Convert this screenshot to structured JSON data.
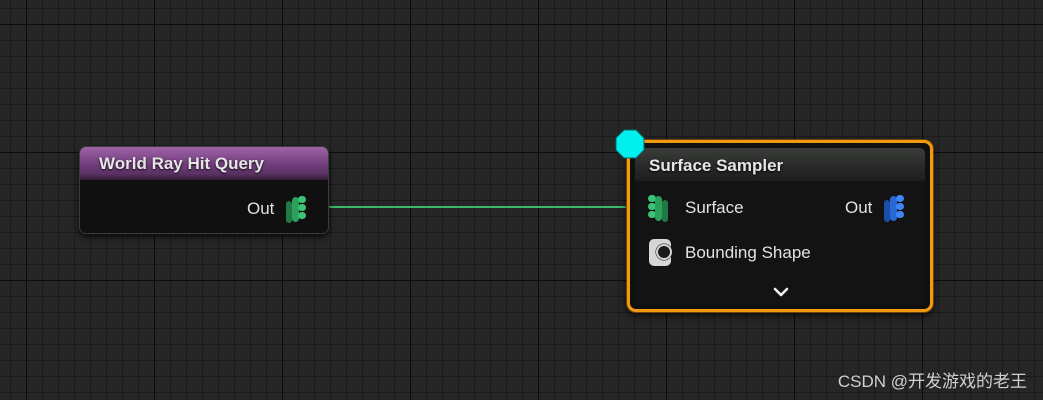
{
  "graph": {
    "nodes": [
      {
        "title": "World Ray Hit Query",
        "output_pin": {
          "label": "Out",
          "icon": "data-stack-pin-icon",
          "color": "#3bb86a"
        }
      },
      {
        "title": "Surface Sampler",
        "selected": true,
        "entry_marker_color": "#00f0f0",
        "input_pins": [
          {
            "label": "Surface",
            "icon": "data-stack-pin-icon",
            "color": "#3bb86a"
          },
          {
            "label": "Bounding Shape",
            "icon": "shape-pin-icon",
            "color": "#d6d6d6"
          }
        ],
        "output_pin": {
          "label": "Out",
          "icon": "data-stack-pin-icon",
          "color": "#2f7bf2"
        },
        "expand_icon": "chevron-down-icon"
      }
    ],
    "connection": {
      "from": "World Ray Hit Query.Out",
      "to": "Surface Sampler.Surface",
      "color": "#3bb86a"
    }
  },
  "colors": {
    "selection_outline": "#f29a10",
    "header_purple": "#8a4f95",
    "grid_background": "#262626"
  },
  "watermark": "CSDN @开发游戏的老王"
}
